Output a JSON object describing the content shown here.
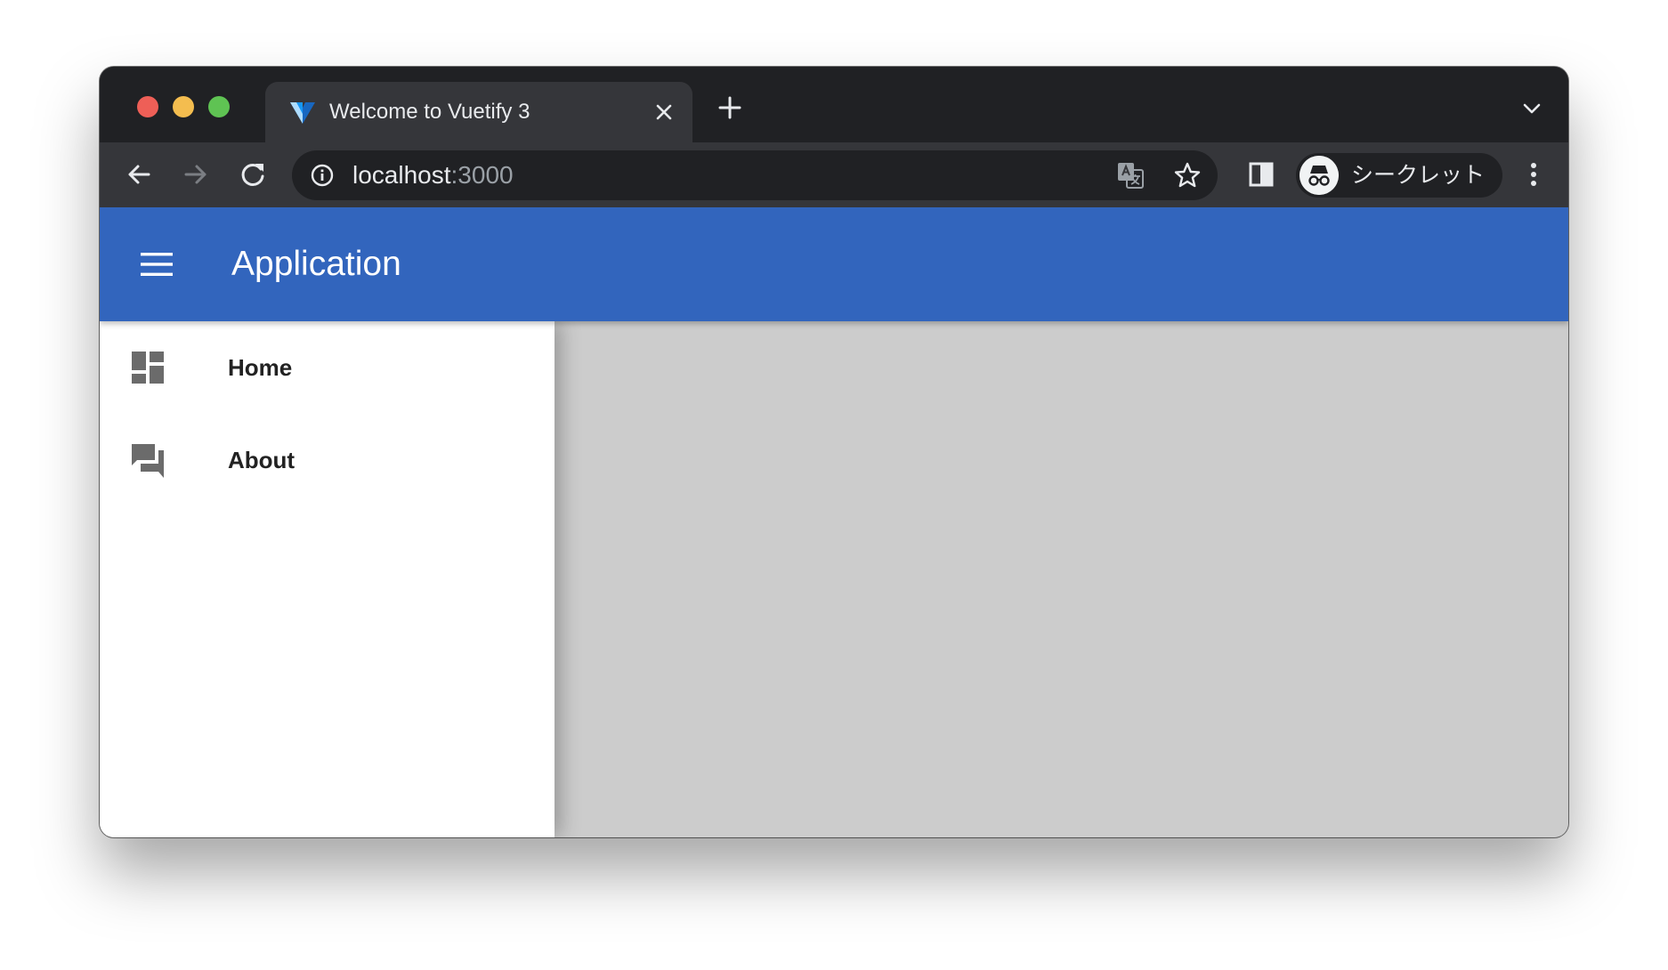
{
  "browser": {
    "tab": {
      "title": "Welcome to Vuetify 3",
      "favicon": "vuetify-logo-icon"
    },
    "address_bar": {
      "host": "localhost",
      "port": ":3000"
    },
    "profile": {
      "label": "シークレット",
      "icon": "incognito-icon"
    },
    "icons": {
      "close": "close-icon",
      "new_tab": "plus-icon",
      "tab_search": "chevron-down-icon",
      "back": "arrow-left-icon",
      "forward": "arrow-right-icon",
      "reload": "reload-icon",
      "info": "info-icon",
      "translate": "translate-icon",
      "bookmark": "star-icon",
      "side_panel": "side-panel-icon",
      "menu": "kebab-menu-icon"
    }
  },
  "app": {
    "title": "Application",
    "colors": {
      "app_bar": "#3265bd",
      "drawer": "#ffffff",
      "main": "#cccccc"
    },
    "nav_items": [
      {
        "label": "Home",
        "icon": "dashboard-icon"
      },
      {
        "label": "About",
        "icon": "forum-icon"
      }
    ]
  }
}
